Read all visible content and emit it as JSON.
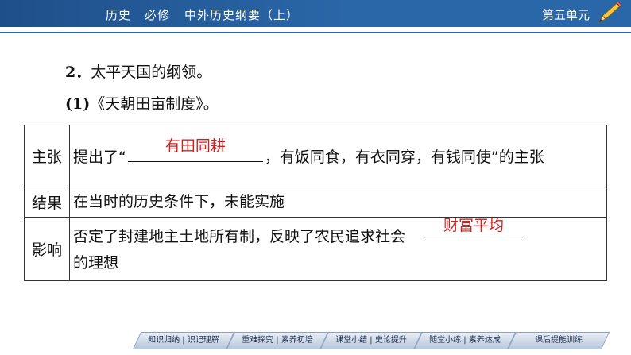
{
  "header": {
    "subject": "历史",
    "course": "必修",
    "book": "中外历史纲要（上）",
    "unit": "第五单元",
    "icon": "pencil-icon"
  },
  "content": {
    "heading_number": "2．",
    "heading_text": "太平天国的纲领。",
    "subheading_number": "(1)",
    "subheading_text": "《天朝田亩制度》。",
    "table": {
      "rows": [
        {
          "label": "主张",
          "text_before": "提出了“",
          "answer": "有田同耕",
          "text_after": "，有饭同食，有衣同穿，有钱同使”的主张"
        },
        {
          "label": "结果",
          "text": "在当时的历史条件下，未能实施"
        },
        {
          "label": "影响",
          "text_before": "否定了封建地主土地所有制，反映了农民追求社会",
          "answer": "财富平均",
          "text_after": "的理想"
        }
      ]
    }
  },
  "footer": {
    "buttons": [
      "知识归纳 | 识记理解",
      "重难探究 | 素养初培",
      "课堂小结 | 史论提升",
      "随堂小练 | 素养达成",
      "课后提能训练"
    ]
  },
  "colors": {
    "header_bg": "#2a67a8",
    "answer": "#d21f1f"
  }
}
